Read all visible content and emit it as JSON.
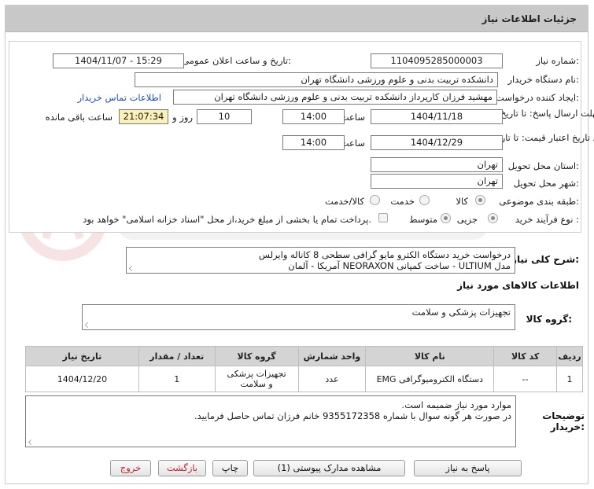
{
  "header": {
    "title": "جزئیات اطلاعات نیاز"
  },
  "need_number": {
    "label": "شماره نیاز:",
    "value": "1104095285000003"
  },
  "announce_datetime": {
    "label": "تاریخ و ساعت اعلان عمومی:",
    "value": "1404/11/07 - 15:29"
  },
  "buyer_org": {
    "label": "نام دستگاه خریدار:",
    "value": "دانشکده تربیت بدنی و علوم ورزشی دانشگاه تهران"
  },
  "requester": {
    "label": "ایجاد کننده درخواست:",
    "value": "مهشید فرزان کارپرداز دانشکده تربیت بدنی و علوم ورزشی دانشگاه تهران",
    "contact_link": "اطلاعات تماس خریدار"
  },
  "deadline": {
    "label": "مهلت ارسال پاسخ: تا تاریخ:",
    "date": "1404/11/18",
    "time_label": "ساعت",
    "time": "14:00",
    "days": "10",
    "days_label": "روز و",
    "remaining": "21:07:34",
    "remaining_label": "ساعت باقی مانده"
  },
  "price_validity": {
    "label": "حداقل تاریخ اعتبار قیمت: تا تاریخ:",
    "date": "1404/12/29",
    "time_label": "ساعت",
    "time": "14:00"
  },
  "province": {
    "label": "استان محل تحویل:",
    "value": "تهران"
  },
  "city": {
    "label": "شهر محل تحویل:",
    "value": "تهران"
  },
  "category": {
    "label": "طبقه بندی موضوعی:",
    "options": [
      "کالا",
      "خدمت",
      "کالا/خدمت"
    ],
    "selected": "کالا"
  },
  "purchase_process": {
    "label": "نوع فرآیند خرید :",
    "options": [
      "جزیی",
      "متوسط"
    ],
    "selected": "جزیی",
    "payment_note": "پرداخت تمام یا بخشی از مبلغ خرید،از محل \"اسناد خزانه اسلامی\" خواهد بود."
  },
  "overall_desc": {
    "label": "شرح کلی نیاز:",
    "line1": "درخواست خرید دستگاه الکترو مایو گرافی سطحی 8 کاناله وایرلس",
    "line2": "مدل ULTIUM - ساخت کمپانی NEORAXON آمریکا - آلمان"
  },
  "goods_info_title": "اطلاعات کالاهای مورد نیاز",
  "goods_group": {
    "label": "گروه کالا:",
    "value": "تجهیزات پزشکی و سلامت"
  },
  "table": {
    "headers": [
      "ردیف",
      "کد کالا",
      "نام کالا",
      "واحد شمارش",
      "گروه کالا",
      "تعداد / مقدار",
      "تاریخ نیاز"
    ],
    "rows": [
      {
        "row": "1",
        "code": "--",
        "name": "دستگاه الکترومیوگرافی EMG",
        "unit": "عدد",
        "group_line1": "تجهیزات پزشکی",
        "group_line2": "و سلامت",
        "qty": "1",
        "date": "1404/12/20"
      }
    ]
  },
  "buyer_notes": {
    "label_line1": "توضیحات",
    "label_line2": "خریدار:",
    "line1": "موارد مورد نیاز ضمیمه است.",
    "line2": "در صورت هر گونه سوال با شماره 9355172358 خانم فرزان تماس حاصل فرمایید."
  },
  "buttons": {
    "reply": "پاسخ به نیاز",
    "attachments": "مشاهده مدارک پیوستی (1)",
    "print": "چاپ",
    "back": "بازگشت",
    "exit": "خروج"
  }
}
